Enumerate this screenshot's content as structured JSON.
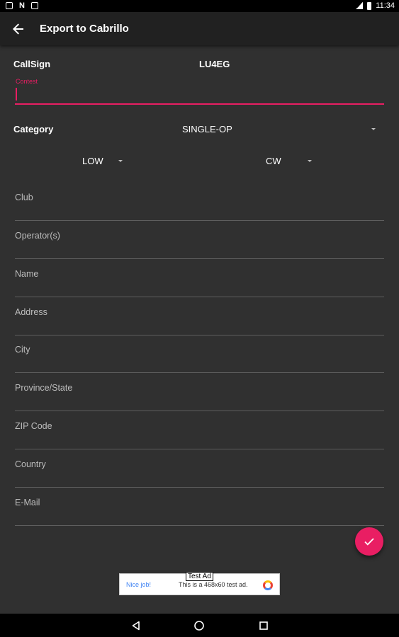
{
  "status_bar": {
    "time": "11:34",
    "left_icons": [
      "notification-icon",
      "n-icon",
      "notification-icon"
    ],
    "right_icons": [
      "signal-icon",
      "battery-icon"
    ]
  },
  "app_bar": {
    "title": "Export to Cabrillo",
    "back_icon": "arrow-back-icon"
  },
  "form": {
    "callsign_label": "CallSign",
    "callsign_value": "LU4EG",
    "contest_label": "Contest",
    "contest_value": "",
    "category_label": "Category",
    "category_value": "SINGLE-OP",
    "power_value": "LOW",
    "mode_value": "CW",
    "fields": [
      {
        "hint": "Club",
        "value": ""
      },
      {
        "hint": "Operator(s)",
        "value": ""
      },
      {
        "hint": "Name",
        "value": ""
      },
      {
        "hint": "Address",
        "value": ""
      },
      {
        "hint": "City",
        "value": ""
      },
      {
        "hint": "Province/State",
        "value": ""
      },
      {
        "hint": "ZIP Code",
        "value": ""
      },
      {
        "hint": "Country",
        "value": ""
      },
      {
        "hint": "E-Mail",
        "value": ""
      }
    ]
  },
  "fab": {
    "icon": "check-icon"
  },
  "ad": {
    "tag": "Test Ad",
    "left_text": "Nice job!",
    "middle_text": "This is a 468x60 test ad."
  },
  "nav_bar": {
    "icons": [
      "nav-back-icon",
      "nav-home-icon",
      "nav-recents-icon"
    ]
  },
  "colors": {
    "accent": "#e91e63",
    "background": "#303030",
    "app_bar": "#212121"
  }
}
